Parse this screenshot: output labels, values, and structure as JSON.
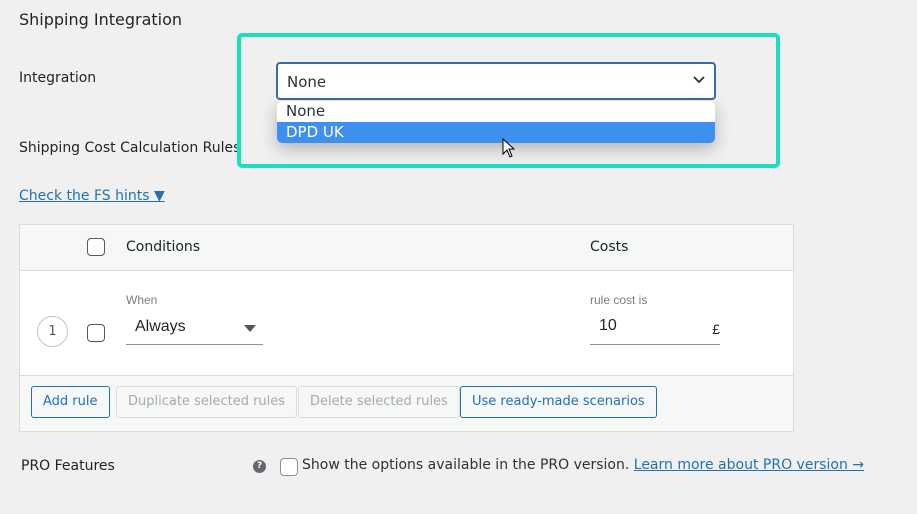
{
  "section_title": "Shipping Integration",
  "integration": {
    "label": "Integration",
    "selected": "None",
    "options": [
      "None",
      "DPD UK"
    ],
    "highlighted_option": "DPD UK"
  },
  "rules": {
    "label": "Shipping Cost Calculation Rules",
    "hints_link": "Check the FS hints ▼",
    "columns": {
      "conditions": "Conditions",
      "costs": "Costs"
    },
    "rows": [
      {
        "number": "1",
        "condition_label": "When",
        "condition_value": "Always",
        "cost_label": "rule cost is",
        "cost_value": "10",
        "currency": "£"
      }
    ],
    "buttons": {
      "add": "Add rule",
      "duplicate": "Duplicate selected rules",
      "delete": "Delete selected rules",
      "scenarios": "Use ready-made scenarios"
    }
  },
  "pro": {
    "label": "PRO Features",
    "help_icon": "?",
    "checkbox_text": "Show the options available in the PRO version.",
    "link_text": "Learn more about PRO version →"
  },
  "colors": {
    "highlight": "#19e0bd",
    "accent": "#2271b1",
    "option_active": "#3d8ff0"
  }
}
